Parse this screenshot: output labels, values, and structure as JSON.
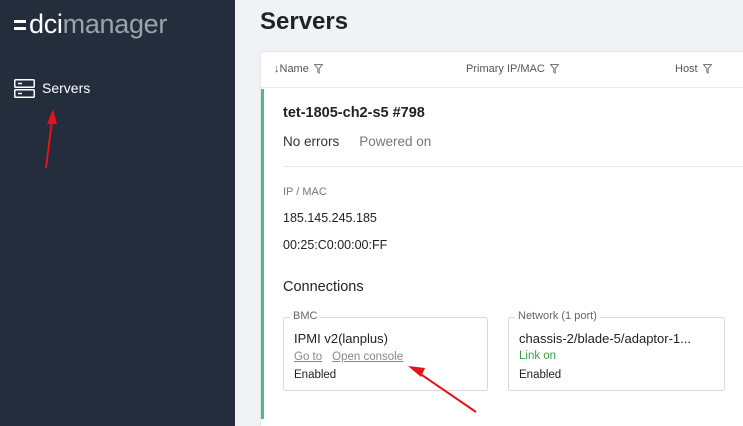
{
  "app": {
    "logo": {
      "prefix": "dci",
      "suffix": "manager"
    }
  },
  "sidebar": {
    "items": [
      {
        "label": "Servers",
        "icon": "server-icon"
      }
    ]
  },
  "page": {
    "title": "Servers"
  },
  "table": {
    "columns": [
      {
        "label": "↓Name",
        "sorted": "desc"
      },
      {
        "label": "Primary IP/MAC"
      },
      {
        "label": "Host"
      }
    ]
  },
  "server": {
    "name": "tet-1805-ch2-s5 #798",
    "errors": "No errors",
    "power": "Powered on",
    "ip_mac_label": "IP / MAC",
    "ip": "185.145.245.185",
    "mac": "00:25:C0:00:00:FF",
    "connections_title": "Connections",
    "bmc": {
      "legend": "BMC",
      "type": "IPMI v2(lanplus)",
      "goto_label": "Go to",
      "console_label": "Open console",
      "state": "Enabled"
    },
    "network": {
      "legend": "Network (1 port)",
      "port": "chassis-2/blade-5/adaptor-1...",
      "link": "Link on",
      "state": "Enabled"
    }
  },
  "colors": {
    "sidebar_bg": "#232d3b",
    "accent_green": "#4cbb8a",
    "link_on": "#3a9d45",
    "annotation_arrow": "#e3131b"
  }
}
